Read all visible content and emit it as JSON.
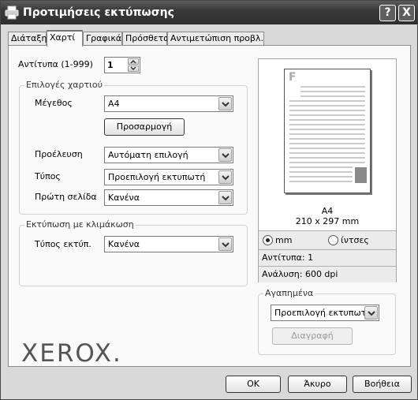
{
  "window": {
    "title": "Προτιμήσεις εκτύπωσης",
    "help_glyph": "?",
    "close_glyph": "X"
  },
  "tabs": [
    {
      "label": "Διάταξη",
      "active": false
    },
    {
      "label": "Χαρτί",
      "active": true
    },
    {
      "label": "Γραφικά",
      "active": false
    },
    {
      "label": "Πρόσθετα",
      "active": false
    },
    {
      "label": "Αντιμετώπιση προβλ.",
      "active": false
    }
  ],
  "copies": {
    "label": "Αντίτυπα (1-999)",
    "value": "1"
  },
  "paper_options": {
    "group_title": "Επιλογές χαρτιού",
    "size_label": "Μέγεθος",
    "size_value": "A4",
    "custom_button": "Προσαρμογή",
    "source_label": "Προέλευση",
    "source_value": "Αυτόματη επιλογή",
    "type_label": "Τύπος",
    "type_value": "Προεπιλογή εκτυπωτή",
    "first_page_label": "Πρώτη σελίδα",
    "first_page_value": "Κανένα"
  },
  "scaling": {
    "group_title": "Εκτύπωση με κλιμάκωση",
    "type_label": "Τύπος εκτύπ.",
    "type_value": "Κανένα"
  },
  "preview": {
    "page_letter": "F",
    "paper_name": "A4",
    "paper_dims": "210 x 297 mm",
    "unit_mm": "mm",
    "unit_inches": "ίντσες",
    "selected_unit": "mm",
    "copies_info": "Αντίτυπα: 1",
    "resolution_info": "Ανάλυση: 600 dpi"
  },
  "favorites": {
    "group_title": "Αγαπημένα",
    "value": "Προεπιλογή εκτυπωτή",
    "delete_button": "Διαγραφή"
  },
  "logo": {
    "text": "XEROX."
  },
  "footer": {
    "ok": "OK",
    "cancel": "Άκυρο",
    "help": "Βοήθεια"
  }
}
